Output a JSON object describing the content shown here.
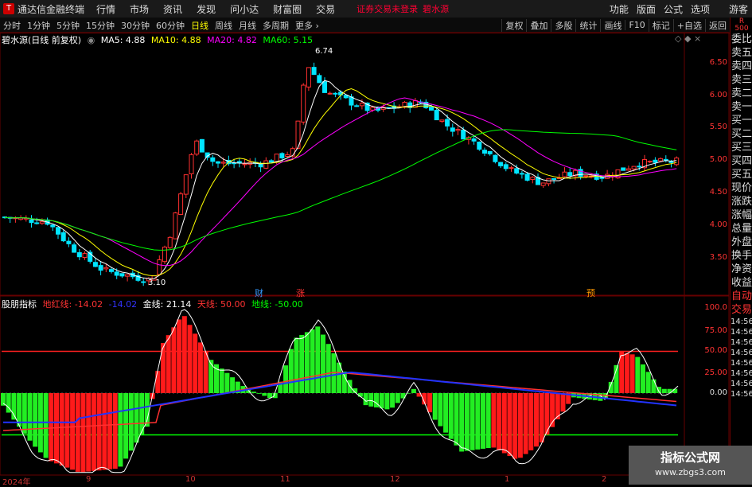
{
  "menubar": {
    "app_name": "通达信金融终端",
    "items": [
      "行情",
      "市场",
      "资讯",
      "发现",
      "问小达",
      "财富圈",
      "交易"
    ],
    "notice": "证券交易未登录",
    "stock": "碧水源",
    "right": [
      "功能",
      "版面",
      "公式",
      "选项"
    ],
    "guest": "游客"
  },
  "toolbar": {
    "periods": [
      "分时",
      "1分钟",
      "5分钟",
      "15分钟",
      "30分钟",
      "60分钟",
      "日线",
      "周线",
      "月线",
      "多周期",
      "更多"
    ],
    "active": "日线",
    "right": [
      "复权",
      "叠加",
      "多股",
      "统计",
      "画线",
      "F10",
      "标记",
      "+自选",
      "返回"
    ]
  },
  "sidebar": {
    "badge": "R\n500",
    "items": [
      "委比",
      "卖五",
      "卖四",
      "卖三",
      "卖二",
      "卖一",
      "买一",
      "买二",
      "买三",
      "买四",
      "买五",
      "现价",
      "涨跌",
      "涨幅",
      "总量",
      "外盘",
      "换手",
      "净资",
      "收益",
      "自动",
      "交易"
    ],
    "times": [
      "14:56",
      "14:56",
      "14:56",
      "14:56",
      "14:56",
      "14:56",
      "14:56",
      "14:56"
    ]
  },
  "main_legend": {
    "title": "碧水源(日线 前复权)",
    "ma5": "MA5: 4.88",
    "ma10": "MA10: 4.88",
    "ma20": "MA20: 4.82",
    "ma60": "MA60: 5.15"
  },
  "indicator_legend": {
    "name": "股朋指标",
    "red_line": "地红线: -14.02",
    "blue_line": "-14.02",
    "gold_line": "金线: 21.14",
    "sky_line": "天线: 50.00",
    "ground_line": "地线: -50.00"
  },
  "price_axis": [
    "6.50",
    "6.00",
    "5.50",
    "5.00",
    "4.50",
    "4.00",
    "3.50"
  ],
  "ind_axis": [
    "100.0",
    "75.00",
    "50.00",
    "25.00",
    "0.00"
  ],
  "x_labels": [
    "2024年",
    "9",
    "10",
    "11",
    "12",
    "1",
    "2"
  ],
  "annotations": {
    "high": "6.74",
    "low": "3.10",
    "cai": "财",
    "zhang": "涨",
    "yu": "预"
  },
  "watermark": {
    "line1": "指标公式网",
    "line2": "www.zbgs3.com"
  },
  "colors": {
    "up": "#ff3030",
    "down": "#00e5ff",
    "ma5": "#ffffff",
    "ma10": "#ffff00",
    "ma20": "#ff00ff",
    "ma60": "#00ff00",
    "bg": "#000000"
  }
}
